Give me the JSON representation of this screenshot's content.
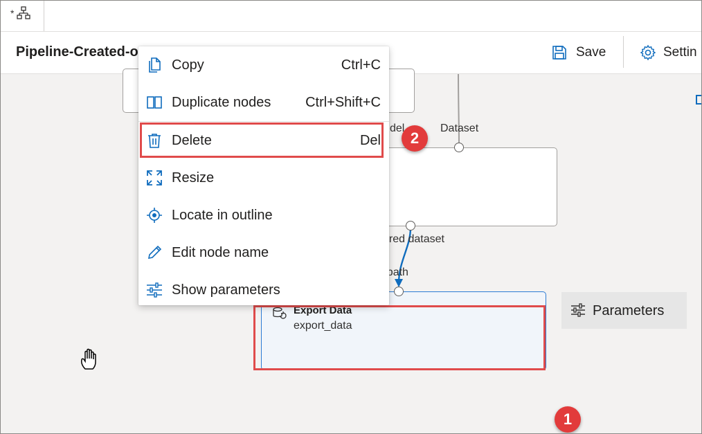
{
  "tab": {
    "dirty_marker": "*"
  },
  "header": {
    "title": "Pipeline-Created-o",
    "save_label": "Save",
    "settings_label": "Settin"
  },
  "canvas": {
    "labels": {
      "model_input": "del",
      "dataset_input": "Dataset",
      "scored_dataset": "ored dataset",
      "output_path": "ut path"
    },
    "export_node": {
      "title": "Export Data",
      "subtitle": "export_data"
    },
    "parameters_button": "Parameters",
    "badges": {
      "one": "1",
      "two": "2"
    }
  },
  "context_menu": {
    "items": [
      {
        "label": "Copy",
        "shortcut": "Ctrl+C",
        "icon": "copy-icon"
      },
      {
        "label": "Duplicate nodes",
        "shortcut": "Ctrl+Shift+C",
        "icon": "duplicate-icon"
      },
      {
        "label": "Delete",
        "shortcut": "Del",
        "icon": "trash-icon"
      },
      {
        "label": "Resize",
        "shortcut": "",
        "icon": "resize-icon"
      },
      {
        "label": "Locate in outline",
        "shortcut": "",
        "icon": "locate-icon"
      },
      {
        "label": "Edit node name",
        "shortcut": "",
        "icon": "pencil-icon"
      },
      {
        "label": "Show parameters",
        "shortcut": "",
        "icon": "sliders-icon"
      }
    ]
  },
  "colors": {
    "accent": "#0f6cbd",
    "highlight": "#e04b4b",
    "badge": "#e23b3b",
    "node_selected_border": "#2b7bd4"
  }
}
